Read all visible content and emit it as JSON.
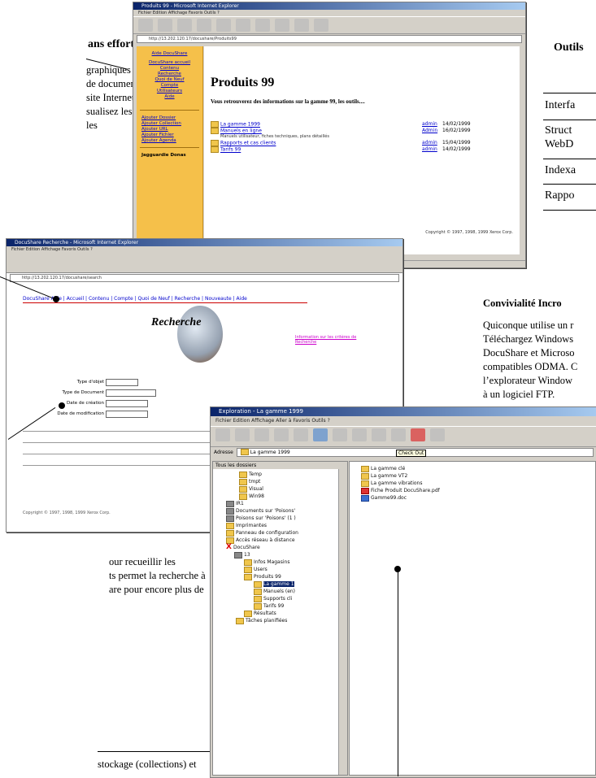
{
  "top_left_callout": {
    "heading": "ans effort",
    "lines": [
      "graphiques et",
      "de documents.",
      "site Internet",
      "sualisez les",
      "les"
    ]
  },
  "top_right": {
    "heading": "Outils",
    "rows": [
      "Interfa",
      "Struct",
      "WebD",
      "Indexa",
      "Rappo"
    ]
  },
  "convivialite": {
    "heading": "Convivialité Incro",
    "lines": [
      "Quiconque utilise un r",
      "Téléchargez Windows",
      "DocuShare et Microso",
      "compatibles ODMA. C",
      "l’explorateur Window",
      "à un logiciel FTP."
    ]
  },
  "bottom_left_callout": {
    "lines": [
      "our recueillir les",
      "ts permet la recherche à",
      "are pour encore plus de"
    ]
  },
  "bottom_callout": {
    "text": "stockage (collections) et"
  },
  "ie_window": {
    "title": "Produits 99 - Microsoft Internet Explorer",
    "menu": "Fichier   Edition   Affichage   Favoris   Outils   ?",
    "address": "http://13.202.120.17/docushare/Produits99",
    "sidebar_items": [
      "Aide  DocuShare",
      "DocuShare accueil",
      "Contenu",
      "Recherche",
      "Quoi de Neuf",
      "Compte",
      "Utilisateurs",
      "Aide",
      "Ajouter Dossier",
      "Ajouter Collection",
      "Ajouter URL",
      "Ajouter Fichier",
      "Ajouter Agenda"
    ],
    "sidebar_footer": "Jagguardie Donas",
    "page_title": "Produits 99",
    "intro": "Vous retrouverez des informations sur la gamme 99, les outils....",
    "list": [
      {
        "name": "La gamme 1999",
        "owner": "admin",
        "date": "14/02/1999"
      },
      {
        "name": "Manuels en ligne",
        "owner": "Admin",
        "date": "16/02/1999"
      },
      {
        "name": "Rapports et cas clients",
        "owner": "admin",
        "date": "15/04/1999"
      },
      {
        "name": "Tarifs 99",
        "owner": "admin",
        "date": "14/02/1999"
      }
    ],
    "list_note": "Manuels utilisateur, fiches techniques, plans détaillés",
    "copyright": "Copyright © 1997, 1998, 1999 Xerox Corp."
  },
  "search_window": {
    "title": "DocuShare Recherche - Microsoft Internet Explorer",
    "menu": "Fichier   Edition   Affichage   Favoris   Outils   ?",
    "address": "http://13.202.120.17/docushare/search",
    "nav": "DocuShare  Aide  |  Accueil  |  Contenu  |  Compte  |  Quoi de Neuf  |  Recherche  |  Nouveaute  |  Aide",
    "heading": "Recherche",
    "side_link": "Information sur les critères de Recherche",
    "labels": [
      "Type d'objet",
      "Type de Document",
      "Date de création",
      "Date de modification"
    ],
    "footer": "Copyright © 1997, 1998, 1999 Xerox Corp."
  },
  "explorer_window": {
    "title": "Exploration - La gamme 1999",
    "menu": "Fichier   Edition   Affichage   Aller à   Favoris   Outils   ?",
    "address_label": "Adresse",
    "address": "La gamme 1999",
    "tooltip": "Check Out",
    "tree_header": "Tous les dossiers",
    "tree": [
      "Temp",
      "tmpt",
      "Visual",
      "Win98",
      "IR1",
      "Documents sur 'Poisons'",
      "Poisons sur 'Poisons' (1 )",
      "Imprimantes",
      "Panneau de configuration",
      "Accès réseau à distance",
      "DocuShare",
      "13",
      "Infos Magasins",
      "Users",
      "Produits 99",
      "La gamme 1",
      "Manuels (en)",
      "Supports cli",
      "Tarifs 99",
      "Résultats",
      "Tâches planifiées"
    ],
    "files": [
      "La gamme clé",
      "La gamme VT2",
      "La gamme vibrations",
      "Fiche Produit DocuShare.pdf",
      "Gamme99.doc"
    ]
  }
}
